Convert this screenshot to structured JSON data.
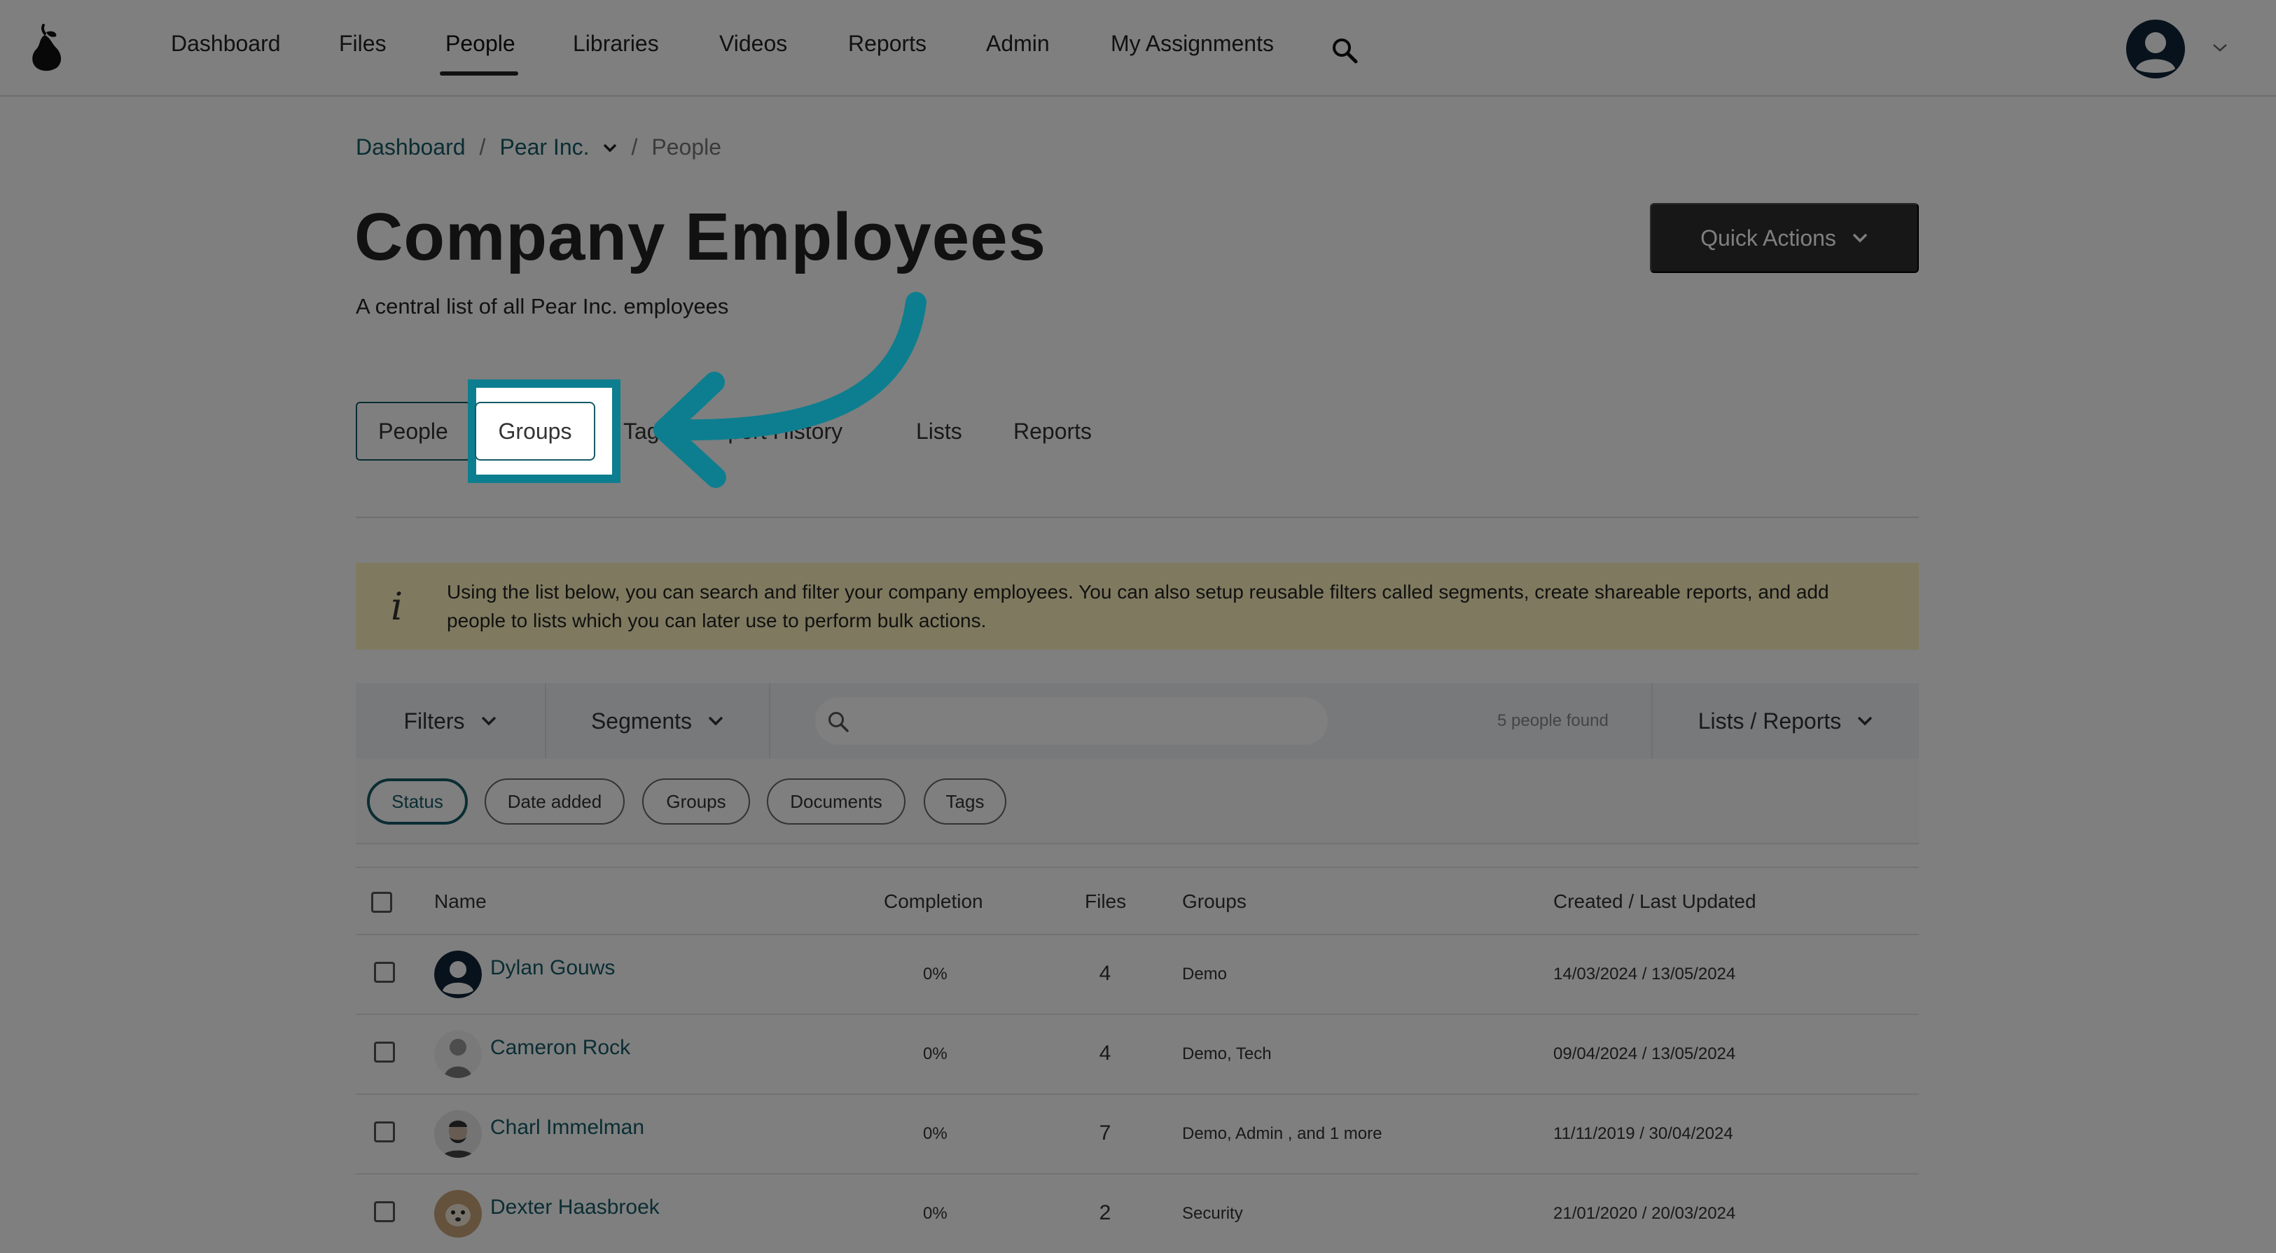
{
  "nav": {
    "items": [
      "Dashboard",
      "Files",
      "People",
      "Libraries",
      "Videos",
      "Reports",
      "Admin",
      "My Assignments"
    ],
    "active": "People"
  },
  "breadcrumb": {
    "home": "Dashboard",
    "org": "Pear Inc.",
    "sep": "/",
    "current": "People"
  },
  "header": {
    "title": "Company Employees",
    "subtitle": "A central list of all Pear Inc. employees",
    "quick_actions": "Quick Actions"
  },
  "tabs": [
    "People",
    "Groups",
    "Tags",
    "Import History",
    "Lists",
    "Reports"
  ],
  "info": {
    "icon": "i",
    "text": "Using the list below, you can search and filter your company employees. You can also setup reusable filters called segments, create shareable reports, and add people to lists which you can later use to perform bulk actions."
  },
  "toolbar": {
    "filters": "Filters",
    "segments": "Segments",
    "search_placeholder": "",
    "found": "5 people found",
    "lists_reports": "Lists / Reports"
  },
  "chips": [
    "Status",
    "Date added",
    "Groups",
    "Documents",
    "Tags"
  ],
  "table": {
    "headers": [
      "Name",
      "Completion",
      "Files",
      "Groups",
      "Created / Last Updated"
    ],
    "rows": [
      {
        "name": "Dylan Gouws",
        "completion": "0%",
        "files": "4",
        "groups": "Demo",
        "dates": "14/03/2024 / 13/05/2024"
      },
      {
        "name": "Cameron Rock",
        "completion": "0%",
        "files": "4",
        "groups": "Demo, Tech",
        "dates": "09/04/2024 / 13/05/2024"
      },
      {
        "name": "Charl Immelman",
        "completion": "0%",
        "files": "7",
        "groups": "Demo, Admin , and 1 more",
        "dates": "11/11/2019 / 30/04/2024"
      },
      {
        "name": "Dexter Haasbroek",
        "completion": "0%",
        "files": "2",
        "groups": "Security",
        "dates": "21/01/2020 / 20/03/2024"
      }
    ]
  },
  "colors": {
    "accent": "#155a66",
    "highlight": "#0d7e8f",
    "info_bg": "#fff4bf",
    "button_dark": "#2e2e2e"
  }
}
